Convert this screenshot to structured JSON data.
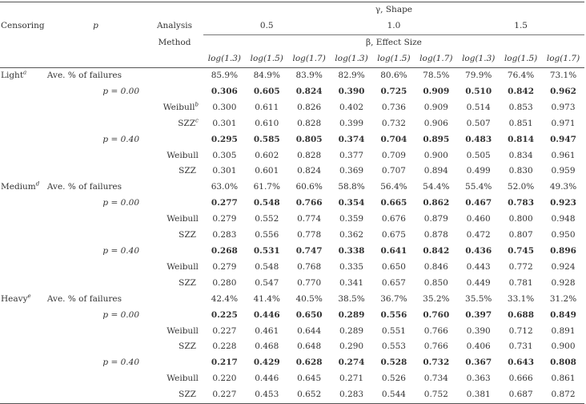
{
  "table": {
    "headers": {
      "censoring": "Censoring",
      "p": "p",
      "analysis_line1": "Analysis",
      "analysis_line2": "Method",
      "gamma_label": "γ, Shape",
      "gamma_values": [
        "0.5",
        "1.0",
        "1.5"
      ],
      "beta_label": "β, Effect Size",
      "beta_values": [
        "log(1.3)",
        "log(1.5)",
        "log(1.7)",
        "log(1.3)",
        "log(1.5)",
        "log(1.7)",
        "log(1.3)",
        "log(1.5)",
        "log(1.7)"
      ]
    },
    "groups": [
      {
        "censoring": "Light",
        "censoring_note": "a",
        "avg_label": "Ave. % of failures",
        "avg_failures": [
          "85.9%",
          "84.9%",
          "83.9%",
          "82.9%",
          "80.6%",
          "78.5%",
          "79.9%",
          "76.4%",
          "73.1%"
        ],
        "blocks": [
          {
            "p_label": "p = 0.00",
            "true_values": [
              "0.306",
              "0.605",
              "0.824",
              "0.390",
              "0.725",
              "0.909",
              "0.510",
              "0.842",
              "0.962"
            ],
            "methods": [
              {
                "name": "Weibull",
                "note": "b",
                "values": [
                  "0.300",
                  "0.611",
                  "0.826",
                  "0.402",
                  "0.736",
                  "0.909",
                  "0.514",
                  "0.853",
                  "0.973"
                ]
              },
              {
                "name": "SZZ",
                "note": "c",
                "values": [
                  "0.301",
                  "0.610",
                  "0.828",
                  "0.399",
                  "0.732",
                  "0.906",
                  "0.507",
                  "0.851",
                  "0.971"
                ]
              }
            ]
          },
          {
            "p_label": "p = 0.40",
            "true_values": [
              "0.295",
              "0.585",
              "0.805",
              "0.374",
              "0.704",
              "0.895",
              "0.483",
              "0.814",
              "0.947"
            ],
            "methods": [
              {
                "name": "Weibull",
                "note": "",
                "values": [
                  "0.305",
                  "0.602",
                  "0.828",
                  "0.377",
                  "0.709",
                  "0.900",
                  "0.505",
                  "0.834",
                  "0.961"
                ]
              },
              {
                "name": "SZZ",
                "note": "",
                "values": [
                  "0.301",
                  "0.601",
                  "0.824",
                  "0.369",
                  "0.707",
                  "0.894",
                  "0.499",
                  "0.830",
                  "0.959"
                ]
              }
            ]
          }
        ]
      },
      {
        "censoring": "Medium",
        "censoring_note": "d",
        "avg_label": "Ave. % of failures",
        "avg_failures": [
          "63.0%",
          "61.7%",
          "60.6%",
          "58.8%",
          "56.4%",
          "54.4%",
          "55.4%",
          "52.0%",
          "49.3%"
        ],
        "blocks": [
          {
            "p_label": "p = 0.00",
            "true_values": [
              "0.277",
              "0.548",
              "0.766",
              "0.354",
              "0.665",
              "0.862",
              "0.467",
              "0.783",
              "0.923"
            ],
            "methods": [
              {
                "name": "Weibull",
                "note": "",
                "values": [
                  "0.279",
                  "0.552",
                  "0.774",
                  "0.359",
                  "0.676",
                  "0.879",
                  "0.460",
                  "0.800",
                  "0.948"
                ]
              },
              {
                "name": "SZZ",
                "note": "",
                "values": [
                  "0.283",
                  "0.556",
                  "0.778",
                  "0.362",
                  "0.675",
                  "0.878",
                  "0.472",
                  "0.807",
                  "0.950"
                ]
              }
            ]
          },
          {
            "p_label": "p = 0.40",
            "true_values": [
              "0.268",
              "0.531",
              "0.747",
              "0.338",
              "0.641",
              "0.842",
              "0.436",
              "0.745",
              "0.896"
            ],
            "methods": [
              {
                "name": "Weibull",
                "note": "",
                "values": [
                  "0.279",
                  "0.548",
                  "0.768",
                  "0.335",
                  "0.650",
                  "0.846",
                  "0.443",
                  "0.772",
                  "0.924"
                ]
              },
              {
                "name": "SZZ",
                "note": "",
                "values": [
                  "0.280",
                  "0.547",
                  "0.770",
                  "0.341",
                  "0.657",
                  "0.850",
                  "0.449",
                  "0.781",
                  "0.928"
                ]
              }
            ]
          }
        ]
      },
      {
        "censoring": "Heavy",
        "censoring_note": "e",
        "avg_label": "Ave. % of failures",
        "avg_failures": [
          "42.4%",
          "41.4%",
          "40.5%",
          "38.5%",
          "36.7%",
          "35.2%",
          "35.5%",
          "33.1%",
          "31.2%"
        ],
        "blocks": [
          {
            "p_label": "p = 0.00",
            "true_values": [
              "0.225",
              "0.446",
              "0.650",
              "0.289",
              "0.556",
              "0.760",
              "0.397",
              "0.688",
              "0.849"
            ],
            "methods": [
              {
                "name": "Weibull",
                "note": "",
                "values": [
                  "0.227",
                  "0.461",
                  "0.644",
                  "0.289",
                  "0.551",
                  "0.766",
                  "0.390",
                  "0.712",
                  "0.891"
                ]
              },
              {
                "name": "SZZ",
                "note": "",
                "values": [
                  "0.228",
                  "0.468",
                  "0.648",
                  "0.290",
                  "0.553",
                  "0.766",
                  "0.406",
                  "0.731",
                  "0.900"
                ]
              }
            ]
          },
          {
            "p_label": "p = 0.40",
            "true_values": [
              "0.217",
              "0.429",
              "0.628",
              "0.274",
              "0.528",
              "0.732",
              "0.367",
              "0.643",
              "0.808"
            ],
            "methods": [
              {
                "name": "Weibull",
                "note": "",
                "values": [
                  "0.220",
                  "0.446",
                  "0.645",
                  "0.271",
                  "0.526",
                  "0.734",
                  "0.363",
                  "0.666",
                  "0.861"
                ]
              },
              {
                "name": "SZZ",
                "note": "",
                "values": [
                  "0.227",
                  "0.453",
                  "0.652",
                  "0.283",
                  "0.544",
                  "0.752",
                  "0.381",
                  "0.687",
                  "0.872"
                ]
              }
            ]
          }
        ]
      }
    ]
  }
}
